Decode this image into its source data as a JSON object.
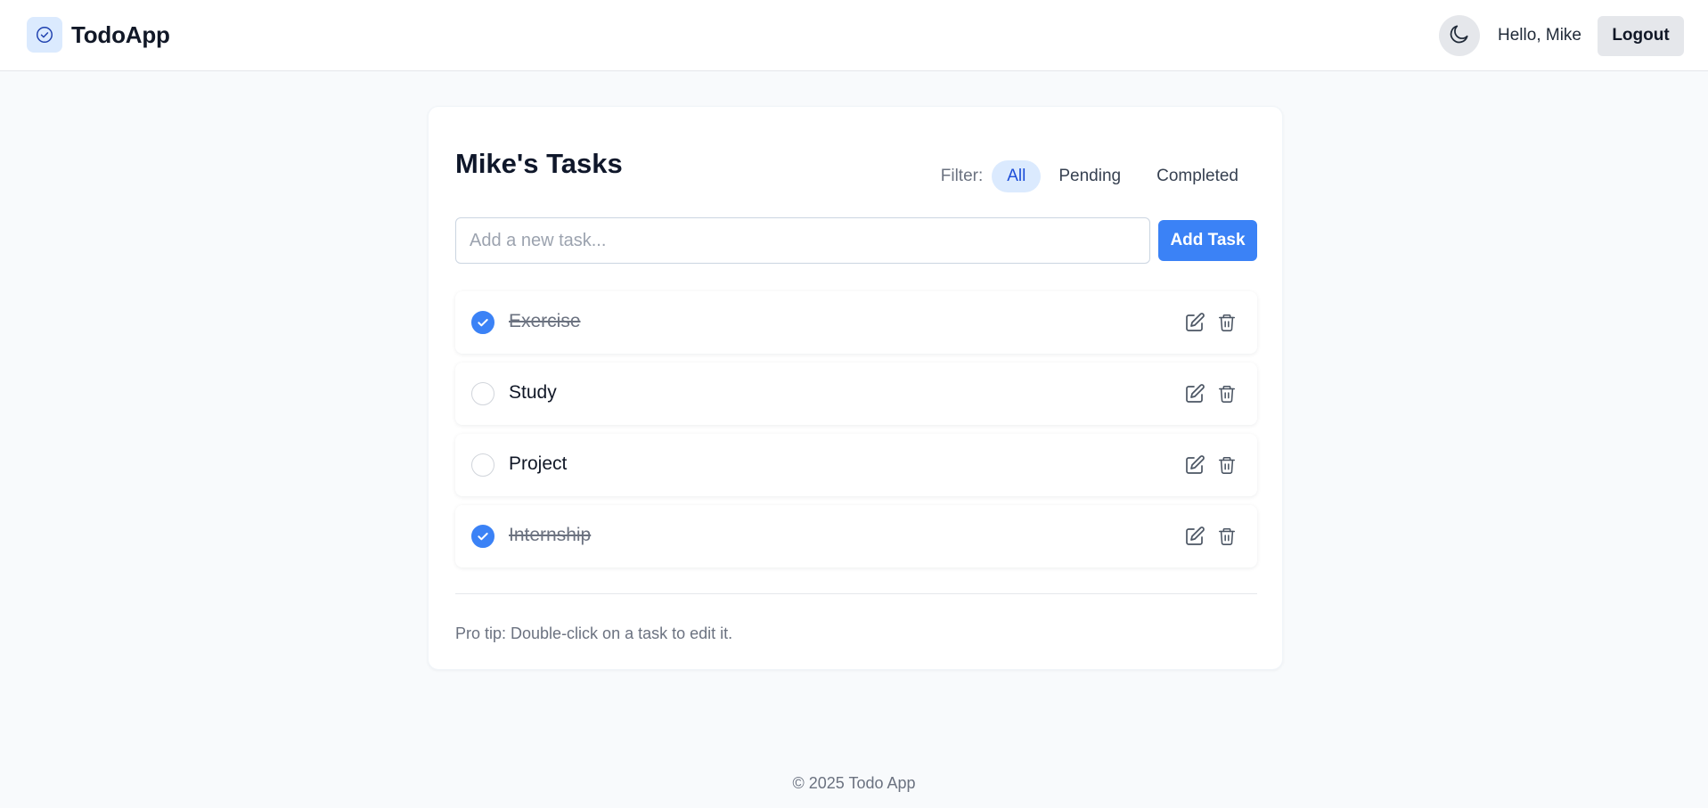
{
  "brand": {
    "name": "TodoApp",
    "logo_icon": "check-circle-icon"
  },
  "header": {
    "theme_icon": "moon-icon",
    "greeting": "Hello, Mike",
    "logout_label": "Logout"
  },
  "main": {
    "title": "Mike's Tasks",
    "filter": {
      "label": "Filter:",
      "options": [
        "All",
        "Pending",
        "Completed"
      ],
      "selected": "All"
    },
    "new_task": {
      "placeholder": "Add a new task...",
      "value": "",
      "add_label": "Add Task"
    },
    "tasks": [
      {
        "text": "Exercise",
        "completed": true
      },
      {
        "text": "Study",
        "completed": false
      },
      {
        "text": "Project",
        "completed": false
      },
      {
        "text": "Internship",
        "completed": true
      }
    ],
    "pro_tip": "Pro tip: Double-click on a task to edit it."
  },
  "footer": {
    "text": "© 2025 Todo App"
  },
  "colors": {
    "accent": "#3b82f6",
    "accent_light": "#dbeafe",
    "background": "#f8fafc"
  }
}
